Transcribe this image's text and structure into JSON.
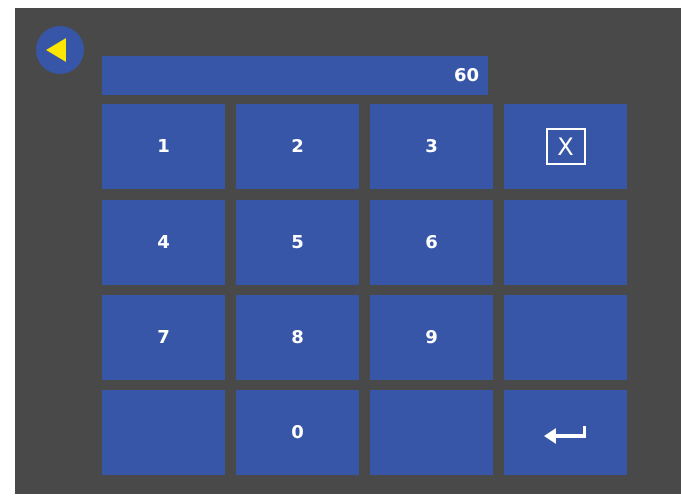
{
  "display": {
    "value": "60"
  },
  "keypad": {
    "keys": [
      "1",
      "2",
      "3",
      "4",
      "5",
      "6",
      "7",
      "8",
      "9",
      "0"
    ]
  },
  "clear_button": {
    "glyph": "X",
    "icon": "clear-icon"
  },
  "enter_button": {
    "icon": "enter-arrow-icon"
  },
  "back_button": {
    "icon": "back-arrow-icon"
  },
  "colors": {
    "panel": "#4a494a",
    "key": "#3756a8",
    "accent_arrow": "#ffe600",
    "text": "#ffffff"
  }
}
